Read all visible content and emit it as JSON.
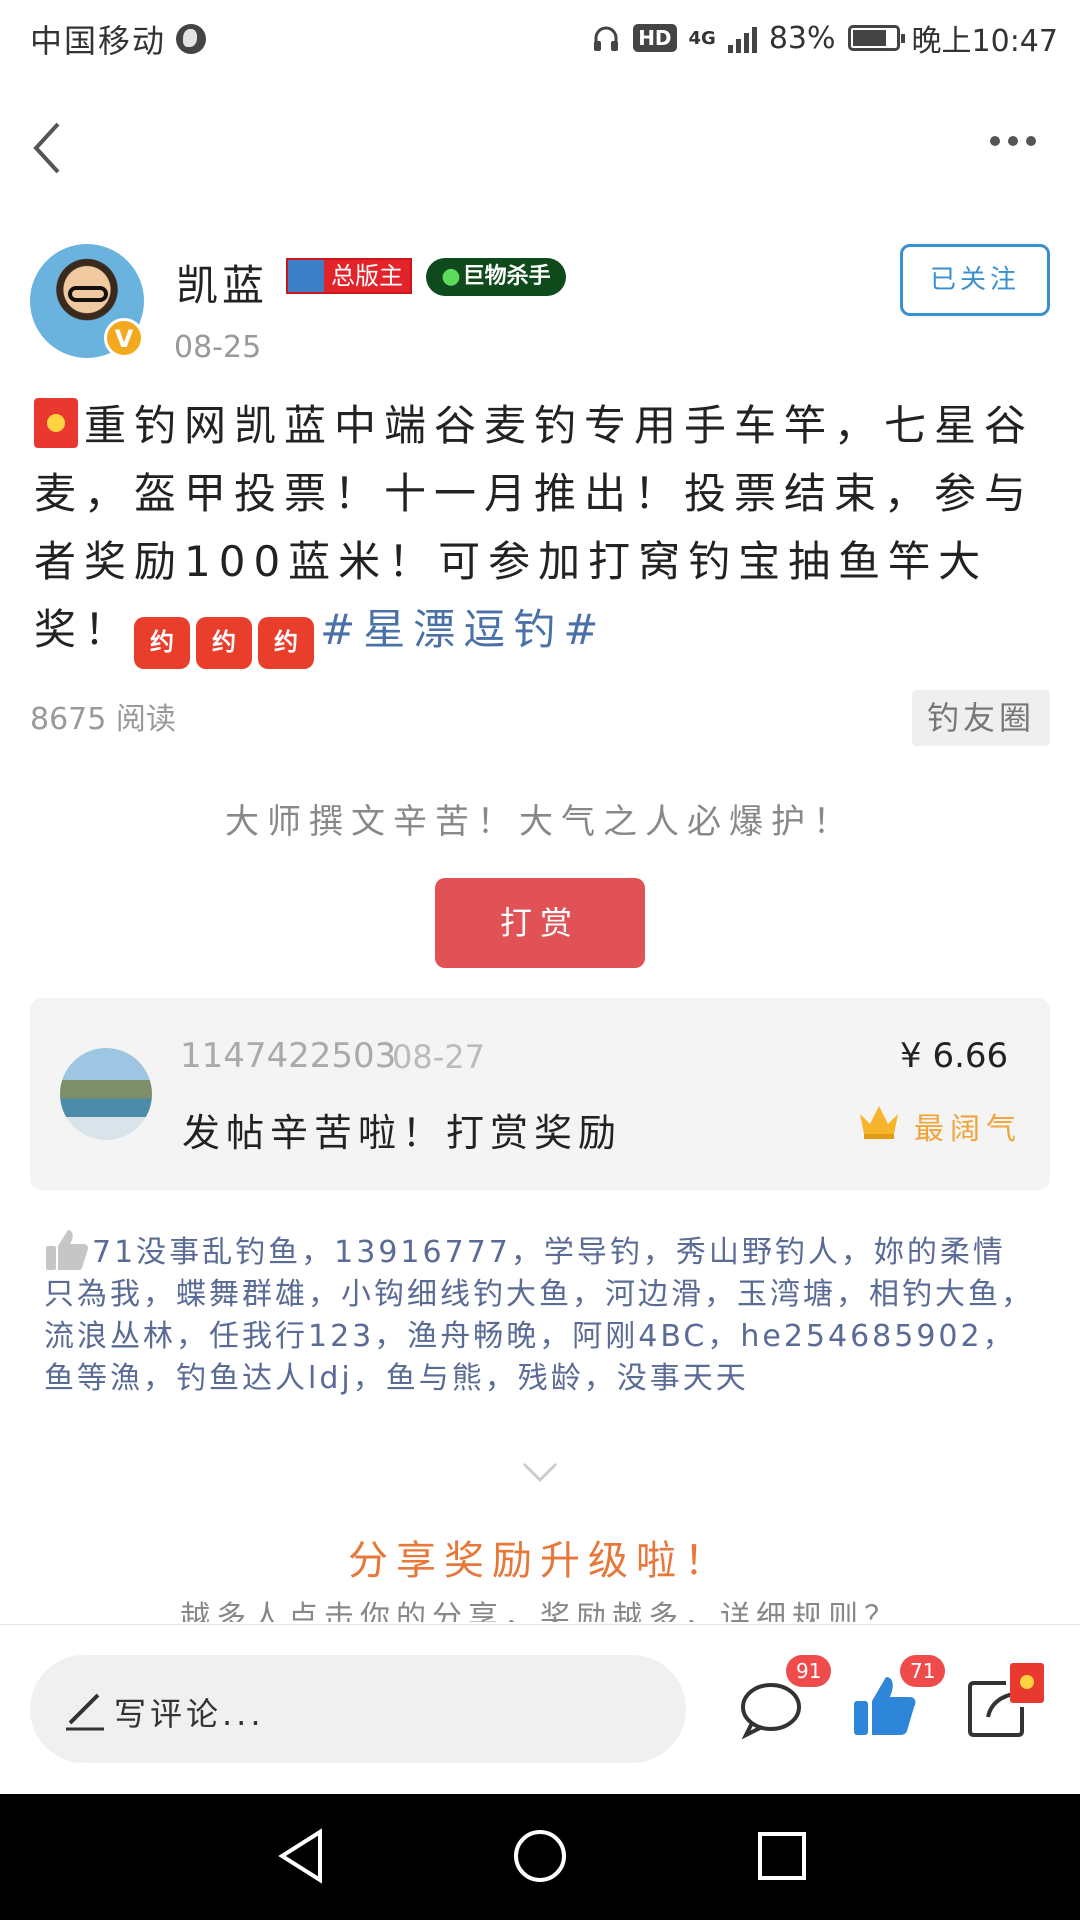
{
  "status_bar": {
    "carrier": "中国移动",
    "hd": "HD",
    "network": "4G",
    "battery_percent": "83%",
    "battery_level": 0.83,
    "time": "晚上10:47"
  },
  "author": {
    "name": "凯蓝",
    "badge_moderator": "总版主",
    "badge_title": "巨物杀手",
    "verified_mark": "V",
    "date": "08-25",
    "follow_label": "已关注"
  },
  "post": {
    "content": "重钓网凯蓝中端谷麦钓专用手车竿，七星谷麦，盔甲投票！十一月推出！投票结束，参与者奖励100蓝米！可参加打窝钓宝抽鱼竿大奖！",
    "emoji_label": "约",
    "topic": "#星漂逗钓#",
    "read_count": "8675 阅读",
    "circle": "钓友圈"
  },
  "reward": {
    "slogan": "大师撰文辛苦！大气之人必爆护！",
    "button_label": "打赏",
    "record": {
      "user": "1147422503",
      "date": "08-27",
      "amount": "¥ 6.66",
      "message": "发帖辛苦啦！打赏奖励",
      "tag": "最阔气"
    }
  },
  "likes": {
    "text": "71没事乱钓鱼，13916777，学导钓，秀山野钓人，妳的柔情只為我，蝶舞群雄，小钩细线钓大鱼，河边滑，玉湾塘，相钓大鱼，流浪丛林，任我行123，渔舟畅晚，阿刚4BC，he254685902，鱼等漁，钓鱼达人ldj，鱼与熊，残龄，没事天天"
  },
  "share": {
    "title": "分享奖励升级啦！",
    "subtitle": "越多人点击你的分享，奖励越多，详细规则？"
  },
  "bottom_bar": {
    "comment_placeholder": "写评论...",
    "comment_count": "91",
    "like_count": "71"
  },
  "colors": {
    "accent_blue": "#3a8fcf",
    "reward_red": "#e05256",
    "share_orange": "#e8773a",
    "like_blue": "#2e86d9"
  },
  "icons": [
    "back-icon",
    "more-icon",
    "crown-icon",
    "like-icon",
    "expand-icon",
    "pencil-icon",
    "comment-icon",
    "thumb-icon",
    "share-icon"
  ]
}
